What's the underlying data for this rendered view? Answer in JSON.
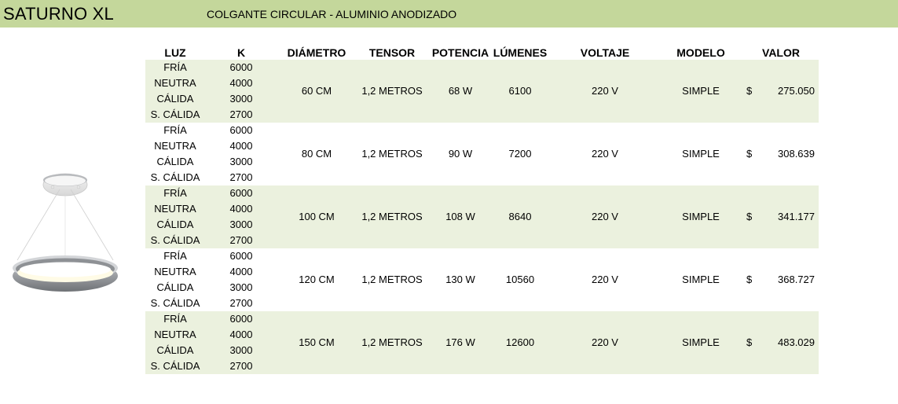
{
  "header": {
    "title": "SATURNO XL",
    "subtitle": "COLGANTE CIRCULAR - ALUMINIO ANODIZADO"
  },
  "columns": {
    "luz": "LUZ",
    "k": "K",
    "diametro": "DIÁMETRO",
    "tensor": "TENSOR",
    "potencia": "POTENCIA",
    "lumenes": "LÚMENES",
    "voltaje": "VOLTAJE",
    "modelo": "MODELO",
    "valor": "VALOR"
  },
  "rows": [
    {
      "lights": [
        {
          "luz": "FRÍA",
          "k": "6000"
        },
        {
          "luz": "NEUTRA",
          "k": "4000"
        },
        {
          "luz": "CÁLIDA",
          "k": "3000"
        },
        {
          "luz": "S. CÁLIDA",
          "k": "2700"
        }
      ],
      "diametro": "60 CM",
      "tensor": "1,2 METROS",
      "potencia": "68 W",
      "lumenes": "6100",
      "voltaje": "220 V",
      "modelo": "SIMPLE",
      "currency": "$",
      "valor": "275.050"
    },
    {
      "lights": [
        {
          "luz": "FRÍA",
          "k": "6000"
        },
        {
          "luz": "NEUTRA",
          "k": "4000"
        },
        {
          "luz": "CÁLIDA",
          "k": "3000"
        },
        {
          "luz": "S. CÁLIDA",
          "k": "2700"
        }
      ],
      "diametro": "80 CM",
      "tensor": "1,2 METROS",
      "potencia": "90 W",
      "lumenes": "7200",
      "voltaje": "220 V",
      "modelo": "SIMPLE",
      "currency": "$",
      "valor": "308.639"
    },
    {
      "lights": [
        {
          "luz": "FRÍA",
          "k": "6000"
        },
        {
          "luz": "NEUTRA",
          "k": "4000"
        },
        {
          "luz": "CÁLIDA",
          "k": "3000"
        },
        {
          "luz": "S. CÁLIDA",
          "k": "2700"
        }
      ],
      "diametro": "100 CM",
      "tensor": "1,2 METROS",
      "potencia": "108 W",
      "lumenes": "8640",
      "voltaje": "220 V",
      "modelo": "SIMPLE",
      "currency": "$",
      "valor": "341.177"
    },
    {
      "lights": [
        {
          "luz": "FRÍA",
          "k": "6000"
        },
        {
          "luz": "NEUTRA",
          "k": "4000"
        },
        {
          "luz": "CÁLIDA",
          "k": "3000"
        },
        {
          "luz": "S. CÁLIDA",
          "k": "2700"
        }
      ],
      "diametro": "120 CM",
      "tensor": "1,2 METROS",
      "potencia": "130 W",
      "lumenes": "10560",
      "voltaje": "220 V",
      "modelo": "SIMPLE",
      "currency": "$",
      "valor": "368.727"
    },
    {
      "lights": [
        {
          "luz": "FRÍA",
          "k": "6000"
        },
        {
          "luz": "NEUTRA",
          "k": "4000"
        },
        {
          "luz": "CÁLIDA",
          "k": "3000"
        },
        {
          "luz": "S. CÁLIDA",
          "k": "2700"
        }
      ],
      "diametro": "150 CM",
      "tensor": "1,2 METROS",
      "potencia": "176 W",
      "lumenes": "12600",
      "voltaje": "220 V",
      "modelo": "SIMPLE",
      "currency": "$",
      "valor": "483.029"
    }
  ],
  "colors": {
    "banner": "#c4d79b",
    "row_shade": "#ebf1de"
  }
}
